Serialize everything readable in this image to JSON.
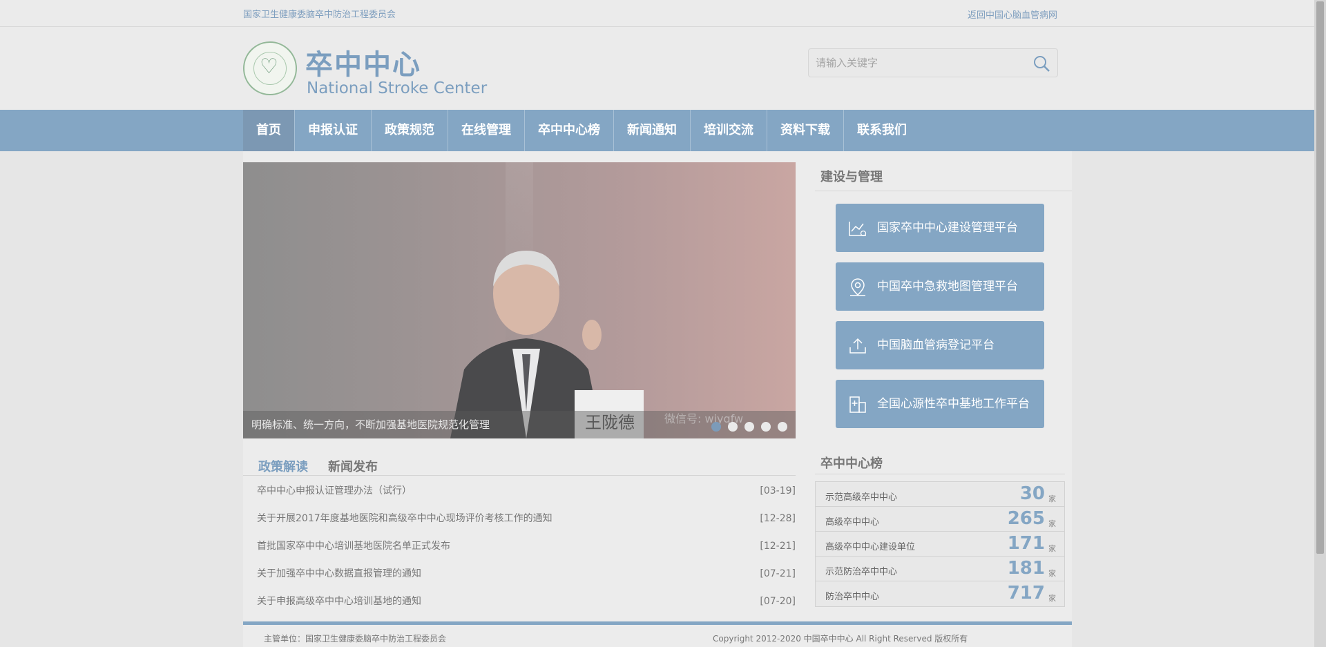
{
  "topbar": {
    "org": "国家卫生健康委脑卒中防治工程委员会",
    "return_link": "返回中国心脑血管病网"
  },
  "header": {
    "logo_cn": "卒中中心",
    "logo_en": "National Stroke Center"
  },
  "search": {
    "placeholder": "请输入关键字"
  },
  "nav": {
    "items": [
      "首页",
      "申报认证",
      "政策规范",
      "在线管理",
      "卒中中心榜",
      "新闻通知",
      "培训交流",
      "资料下载",
      "联系我们"
    ]
  },
  "slider": {
    "caption": "明确标准、统一方向，不断加强基地医院规范化管理",
    "watermark": "微信号: wjyqfw",
    "nameplate": "王陇德"
  },
  "news": {
    "tabs": [
      "政策解读",
      "新闻发布"
    ],
    "items": [
      {
        "title": "卒中中心申报认证管理办法（试行）",
        "date": "[03-19]"
      },
      {
        "title": "关于开展2017年度基地医院和高级卒中中心现场评价考核工作的通知",
        "date": "[12-28]"
      },
      {
        "title": "首批国家卒中中心培训基地医院名单正式发布",
        "date": "[12-21]"
      },
      {
        "title": "关于加强卒中中心数据直报管理的通知",
        "date": "[07-21]"
      },
      {
        "title": "关于申报高级卒中中心培训基地的通知",
        "date": "[07-20]"
      }
    ]
  },
  "side": {
    "section_title": "建设与管理",
    "platforms": [
      {
        "label": "国家卒中中心建设管理平台",
        "icon": "chart-gear-icon"
      },
      {
        "label": "中国卒中急救地图管理平台",
        "icon": "map-pin-icon"
      },
      {
        "label": "中国脑血管病登记平台",
        "icon": "upload-icon"
      },
      {
        "label": "全国心源性卒中基地工作平台",
        "icon": "hospital-icon"
      }
    ],
    "ranking_title": "卒中中心榜",
    "ranking": [
      {
        "label": "示范高级卒中中心",
        "count": "30",
        "unit": "家"
      },
      {
        "label": "高级卒中中心",
        "count": "265",
        "unit": "家"
      },
      {
        "label": "高级卒中中心建设单位",
        "count": "171",
        "unit": "家"
      },
      {
        "label": "示范防治卒中中心",
        "count": "181",
        "unit": "家"
      },
      {
        "label": "防治卒中中心",
        "count": "717",
        "unit": "家"
      }
    ]
  },
  "footer": {
    "host": "主管单位：国家卫生健康委脑卒中防治工程委员会",
    "copyright": "Copyright 2012-2020 中国卒中中心 All Right Reserved 版权所有"
  },
  "colors": {
    "accent": "#84a6c4",
    "text": "#777777"
  }
}
